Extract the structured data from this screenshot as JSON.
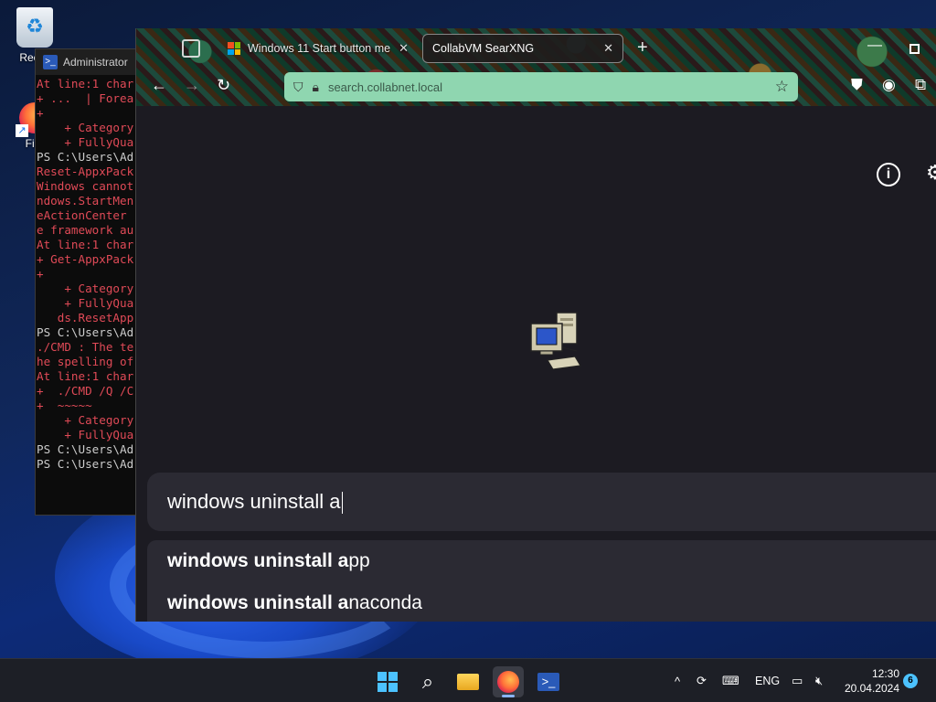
{
  "desktop": {
    "icons": [
      {
        "label": "Recycle Bin",
        "visible_label": "Recyc"
      },
      {
        "label": "Firefox",
        "visible_label": "Fire"
      }
    ]
  },
  "powershell": {
    "title": "Administrator",
    "lines": [
      {
        "text": "At line:1 char",
        "kind": "err"
      },
      {
        "text": "+ ...  | Forea",
        "kind": "err"
      },
      {
        "text": "+",
        "kind": "err"
      },
      {
        "text": "    + Category",
        "kind": "err"
      },
      {
        "text": "    + FullyQua",
        "kind": "err"
      },
      {
        "text": "",
        "kind": "norm"
      },
      {
        "text": "PS C:\\Users\\Ad",
        "kind": "norm"
      },
      {
        "text": "Reset-AppxPack",
        "kind": "err"
      },
      {
        "text": "Windows cannot",
        "kind": "err"
      },
      {
        "text": "ndows.StartMen",
        "kind": "err"
      },
      {
        "text": "eActionCenter",
        "kind": "err"
      },
      {
        "text": "e framework au",
        "kind": "err"
      },
      {
        "text": "At line:1 char",
        "kind": "err"
      },
      {
        "text": "+ Get-AppxPack",
        "kind": "err"
      },
      {
        "text": "+",
        "kind": "err"
      },
      {
        "text": "    + Category",
        "kind": "err"
      },
      {
        "text": "    + FullyQua",
        "kind": "err"
      },
      {
        "text": "   ds.ResetApp",
        "kind": "err"
      },
      {
        "text": "",
        "kind": "norm"
      },
      {
        "text": "PS C:\\Users\\Ad",
        "kind": "norm"
      },
      {
        "text": "./CMD : The te",
        "kind": "err"
      },
      {
        "text": "he spelling of",
        "kind": "err"
      },
      {
        "text": "At line:1 char",
        "kind": "err"
      },
      {
        "text": "+  ./CMD /Q /C",
        "kind": "err"
      },
      {
        "text": "+  ~~~~~",
        "kind": "err"
      },
      {
        "text": "    + Category",
        "kind": "err"
      },
      {
        "text": "    + FullyQua",
        "kind": "err"
      },
      {
        "text": "",
        "kind": "norm"
      },
      {
        "text": "PS C:\\Users\\Ad",
        "kind": "norm"
      },
      {
        "text": "PS C:\\Users\\Ad",
        "kind": "norm"
      }
    ]
  },
  "browser": {
    "tabs": [
      {
        "title": "Windows 11 Start button me",
        "active": false,
        "favicon": "windows-logo"
      },
      {
        "title": "CollabVM SearXNG",
        "active": true,
        "favicon": "none"
      }
    ],
    "new_tab_label": "+",
    "url": "search.collabnet.local",
    "search": {
      "query": "windows uninstall a",
      "suggestions": [
        {
          "bold": "windows uninstall a",
          "rest": "pp"
        },
        {
          "bold": "windows uninstall a",
          "rest": "naconda"
        }
      ]
    }
  },
  "taskbar": {
    "apps": [
      "start",
      "search",
      "file-explorer",
      "firefox",
      "powershell"
    ],
    "active_app": "firefox",
    "language": "ENG",
    "time": "12:30",
    "date": "20.04.2024",
    "notification_count": "6"
  },
  "colors": {
    "url_bar_bg": "#8fd6b0",
    "ps_error": "#e04a57",
    "accent": "#4cc2ff"
  }
}
